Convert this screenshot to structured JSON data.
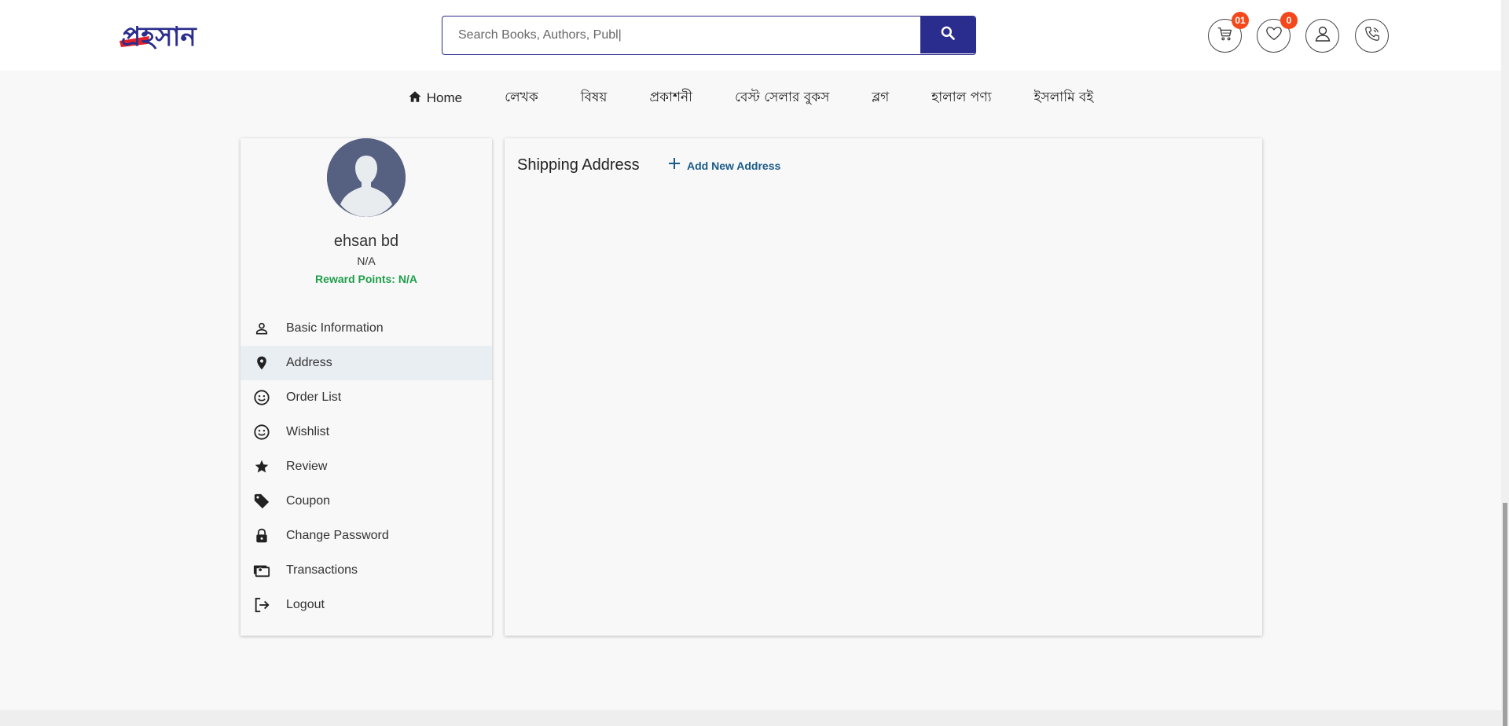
{
  "header": {
    "logo_text": "প্রহসান",
    "search_placeholder": "Search Books, Authors, Publ|",
    "cart_count": "01",
    "wishlist_count": "0"
  },
  "nav": {
    "items": [
      {
        "label": "Home"
      },
      {
        "label": "লেখক"
      },
      {
        "label": "বিষয়"
      },
      {
        "label": "প্রকাশনী"
      },
      {
        "label": "বেস্ট সেলার বুকস"
      },
      {
        "label": "ব্লগ"
      },
      {
        "label": "হালাল পণ্য"
      },
      {
        "label": "ইসলামি বই"
      }
    ]
  },
  "profile": {
    "name": "ehsan bd",
    "sub": "N/A",
    "reward": "Reward Points: N/A"
  },
  "menu": {
    "items": [
      {
        "label": "Basic Information",
        "icon": "person-icon"
      },
      {
        "label": "Address",
        "icon": "location-pin-icon",
        "active": true
      },
      {
        "label": "Order List",
        "icon": "smiley-icon"
      },
      {
        "label": "Wishlist",
        "icon": "smiley-icon"
      },
      {
        "label": "Review",
        "icon": "star-icon"
      },
      {
        "label": "Coupon",
        "icon": "tag-icon"
      },
      {
        "label": "Change Password",
        "icon": "lock-icon"
      },
      {
        "label": "Transactions",
        "icon": "money-icon"
      },
      {
        "label": "Logout",
        "icon": "logout-icon"
      }
    ]
  },
  "main": {
    "title": "Shipping Address",
    "add_label": "Add New Address"
  },
  "colors": {
    "brand": "#2b2d8e",
    "badge": "#f4481c",
    "reward": "#1e9e4a",
    "link": "#1a5b8a"
  }
}
